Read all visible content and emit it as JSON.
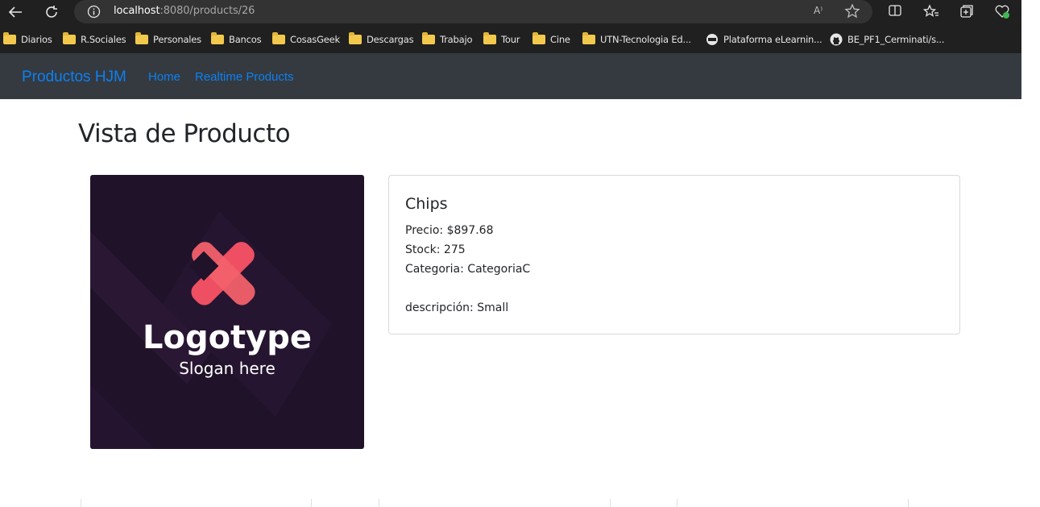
{
  "browser": {
    "url_host": "localhost",
    "url_path": ":8080/products/26",
    "read_aloud_label": "A⁾",
    "bookmarks": [
      {
        "label": "Diarios",
        "icon": "folder-icon"
      },
      {
        "label": "R.Sociales",
        "icon": "folder-icon"
      },
      {
        "label": "Personales",
        "icon": "folder-icon"
      },
      {
        "label": "Bancos",
        "icon": "folder-icon"
      },
      {
        "label": "CosasGeek",
        "icon": "folder-icon"
      },
      {
        "label": "Descargas",
        "icon": "folder-icon"
      },
      {
        "label": "Trabajo",
        "icon": "folder-icon"
      },
      {
        "label": "Tour",
        "icon": "folder-icon"
      },
      {
        "label": "Cine",
        "icon": "folder-icon"
      },
      {
        "label": "UTN-Tecnologia Ed...",
        "icon": "folder-icon"
      },
      {
        "label": "Plataforma eLearnin...",
        "icon": "site-icon"
      },
      {
        "label": "BE_PF1_Cerminati/s...",
        "icon": "github-icon"
      }
    ]
  },
  "navbar": {
    "brand": "Productos HJM",
    "links": [
      "Home",
      "Realtime Products"
    ]
  },
  "page": {
    "title": "Vista de Producto"
  },
  "product": {
    "image_text": "Logotype",
    "image_slogan": "Slogan here",
    "name": "Chips",
    "price": "Precio: $897.68",
    "stock": "Stock: 275",
    "category": "Categoria: CategoriaC",
    "description": "descripción: Small"
  },
  "colors": {
    "navbar_bg": "#343a40",
    "link": "#0d80f2",
    "logo_bg": "#1f1229",
    "logo_accent": "#f0525f"
  }
}
